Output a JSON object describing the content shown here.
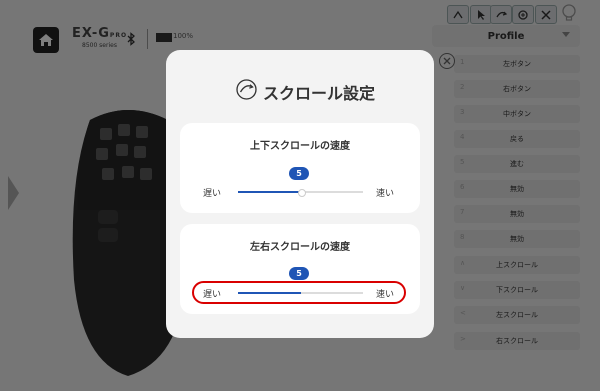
{
  "header": {
    "brand_name": "EX-G",
    "brand_suffix": "PRO",
    "brand_series": "8500 series",
    "battery_text": "100%"
  },
  "toolbar": {
    "buttons": [
      "tilt-icon",
      "cursor-icon",
      "scroll-icon",
      "cycle-icon",
      "close-icon"
    ],
    "bulb": "bulb-icon"
  },
  "profile": {
    "label": "Profile",
    "rows": [
      {
        "num": "1",
        "label": "左ボタン"
      },
      {
        "num": "2",
        "label": "右ボタン"
      },
      {
        "num": "3",
        "label": "中ボタン"
      },
      {
        "num": "4",
        "label": "戻る"
      },
      {
        "num": "5",
        "label": "進む"
      },
      {
        "num": "6",
        "label": "無効"
      },
      {
        "num": "7",
        "label": "無効"
      },
      {
        "num": "8",
        "label": "無効"
      },
      {
        "num": "∧",
        "label": "上スクロール"
      },
      {
        "num": "∨",
        "label": "下スクロール"
      },
      {
        "num": "<",
        "label": "左スクロール"
      },
      {
        "num": ">",
        "label": "右スクロール"
      }
    ]
  },
  "modal": {
    "title": "スクロール設定",
    "vertical": {
      "title": "上下スクロールの速度",
      "value": "5",
      "slow_label": "遅い",
      "fast_label": "速い",
      "level": 0.5
    },
    "horizontal": {
      "title": "左右スクロールの速度",
      "value": "5",
      "slow_label": "遅い",
      "fast_label": "速い",
      "level": 0.5
    }
  },
  "colors": {
    "accent": "#1f55b5",
    "highlight": "#d90000"
  }
}
